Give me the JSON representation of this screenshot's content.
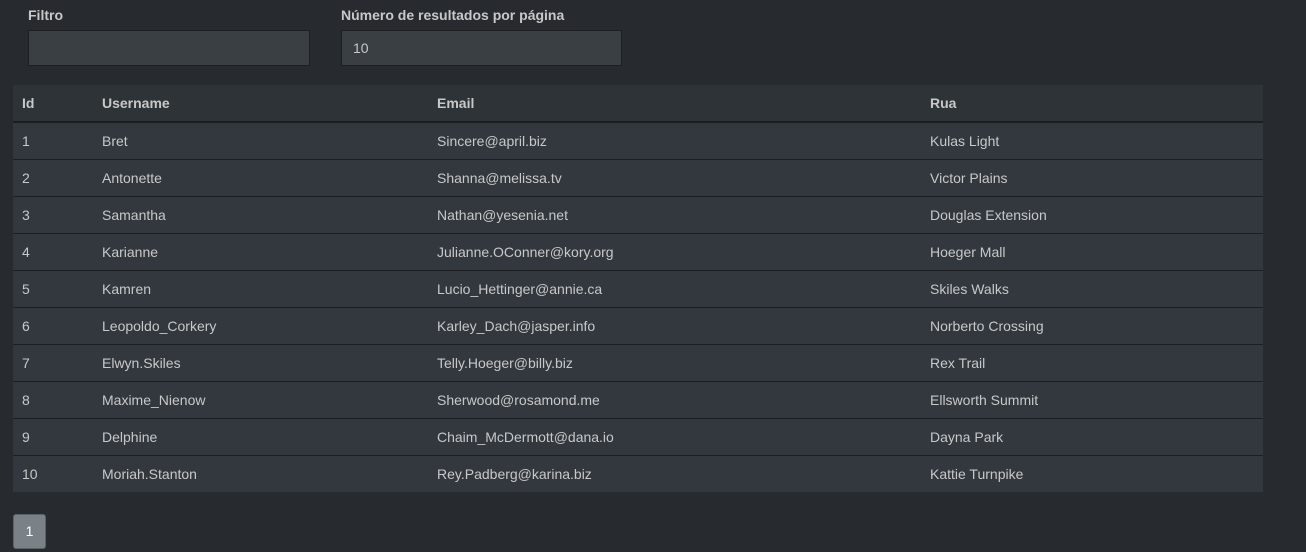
{
  "filters": {
    "filter_label": "Filtro",
    "filter_value": "",
    "per_page_label": "Número de resultados por página",
    "per_page_value": "10"
  },
  "table": {
    "columns": [
      "Id",
      "Username",
      "Email",
      "Rua"
    ],
    "rows": [
      {
        "id": "1",
        "username": "Bret",
        "email": "Sincere@april.biz",
        "street": "Kulas Light"
      },
      {
        "id": "2",
        "username": "Antonette",
        "email": "Shanna@melissa.tv",
        "street": "Victor Plains"
      },
      {
        "id": "3",
        "username": "Samantha",
        "email": "Nathan@yesenia.net",
        "street": "Douglas Extension"
      },
      {
        "id": "4",
        "username": "Karianne",
        "email": "Julianne.OConner@kory.org",
        "street": "Hoeger Mall"
      },
      {
        "id": "5",
        "username": "Kamren",
        "email": "Lucio_Hettinger@annie.ca",
        "street": "Skiles Walks"
      },
      {
        "id": "6",
        "username": "Leopoldo_Corkery",
        "email": "Karley_Dach@jasper.info",
        "street": "Norberto Crossing"
      },
      {
        "id": "7",
        "username": "Elwyn.Skiles",
        "email": "Telly.Hoeger@billy.biz",
        "street": "Rex Trail"
      },
      {
        "id": "8",
        "username": "Maxime_Nienow",
        "email": "Sherwood@rosamond.me",
        "street": "Ellsworth Summit"
      },
      {
        "id": "9",
        "username": "Delphine",
        "email": "Chaim_McDermott@dana.io",
        "street": "Dayna Park"
      },
      {
        "id": "10",
        "username": "Moriah.Stanton",
        "email": "Rey.Padberg@karina.biz",
        "street": "Kattie Turnpike"
      }
    ]
  },
  "pagination": {
    "pages": [
      "1"
    ],
    "current": "1"
  },
  "colors": {
    "background": "#272b30",
    "input_bg": "#3a3f44",
    "row_bg": "#32383e",
    "header_bg": "#2e3338",
    "page_active": "#7a8288"
  }
}
